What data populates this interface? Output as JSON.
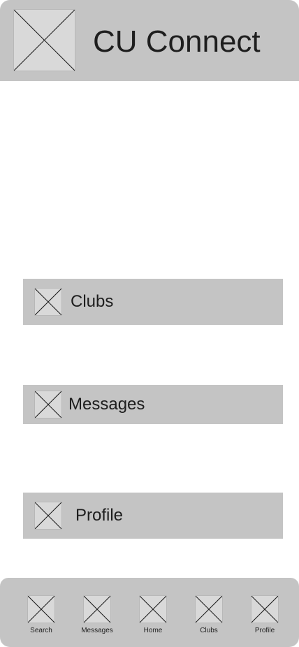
{
  "header": {
    "title": "CU Connect",
    "logo_icon": "image-placeholder-icon"
  },
  "menu": [
    {
      "label": "Clubs",
      "icon": "image-placeholder-icon"
    },
    {
      "label": "Messages",
      "icon": "image-placeholder-icon"
    },
    {
      "label": "Profile",
      "icon": "image-placeholder-icon"
    }
  ],
  "bottom_nav": [
    {
      "label": "Search",
      "icon": "image-placeholder-icon"
    },
    {
      "label": "Messages",
      "icon": "image-placeholder-icon"
    },
    {
      "label": "Home",
      "icon": "image-placeholder-icon"
    },
    {
      "label": "Clubs",
      "icon": "image-placeholder-icon"
    },
    {
      "label": "Profile",
      "icon": "image-placeholder-icon"
    }
  ],
  "colors": {
    "panel": "#c4c4c4",
    "placeholder": "#d9d9d9",
    "background": "#ffffff",
    "text": "#1e1e1e"
  }
}
